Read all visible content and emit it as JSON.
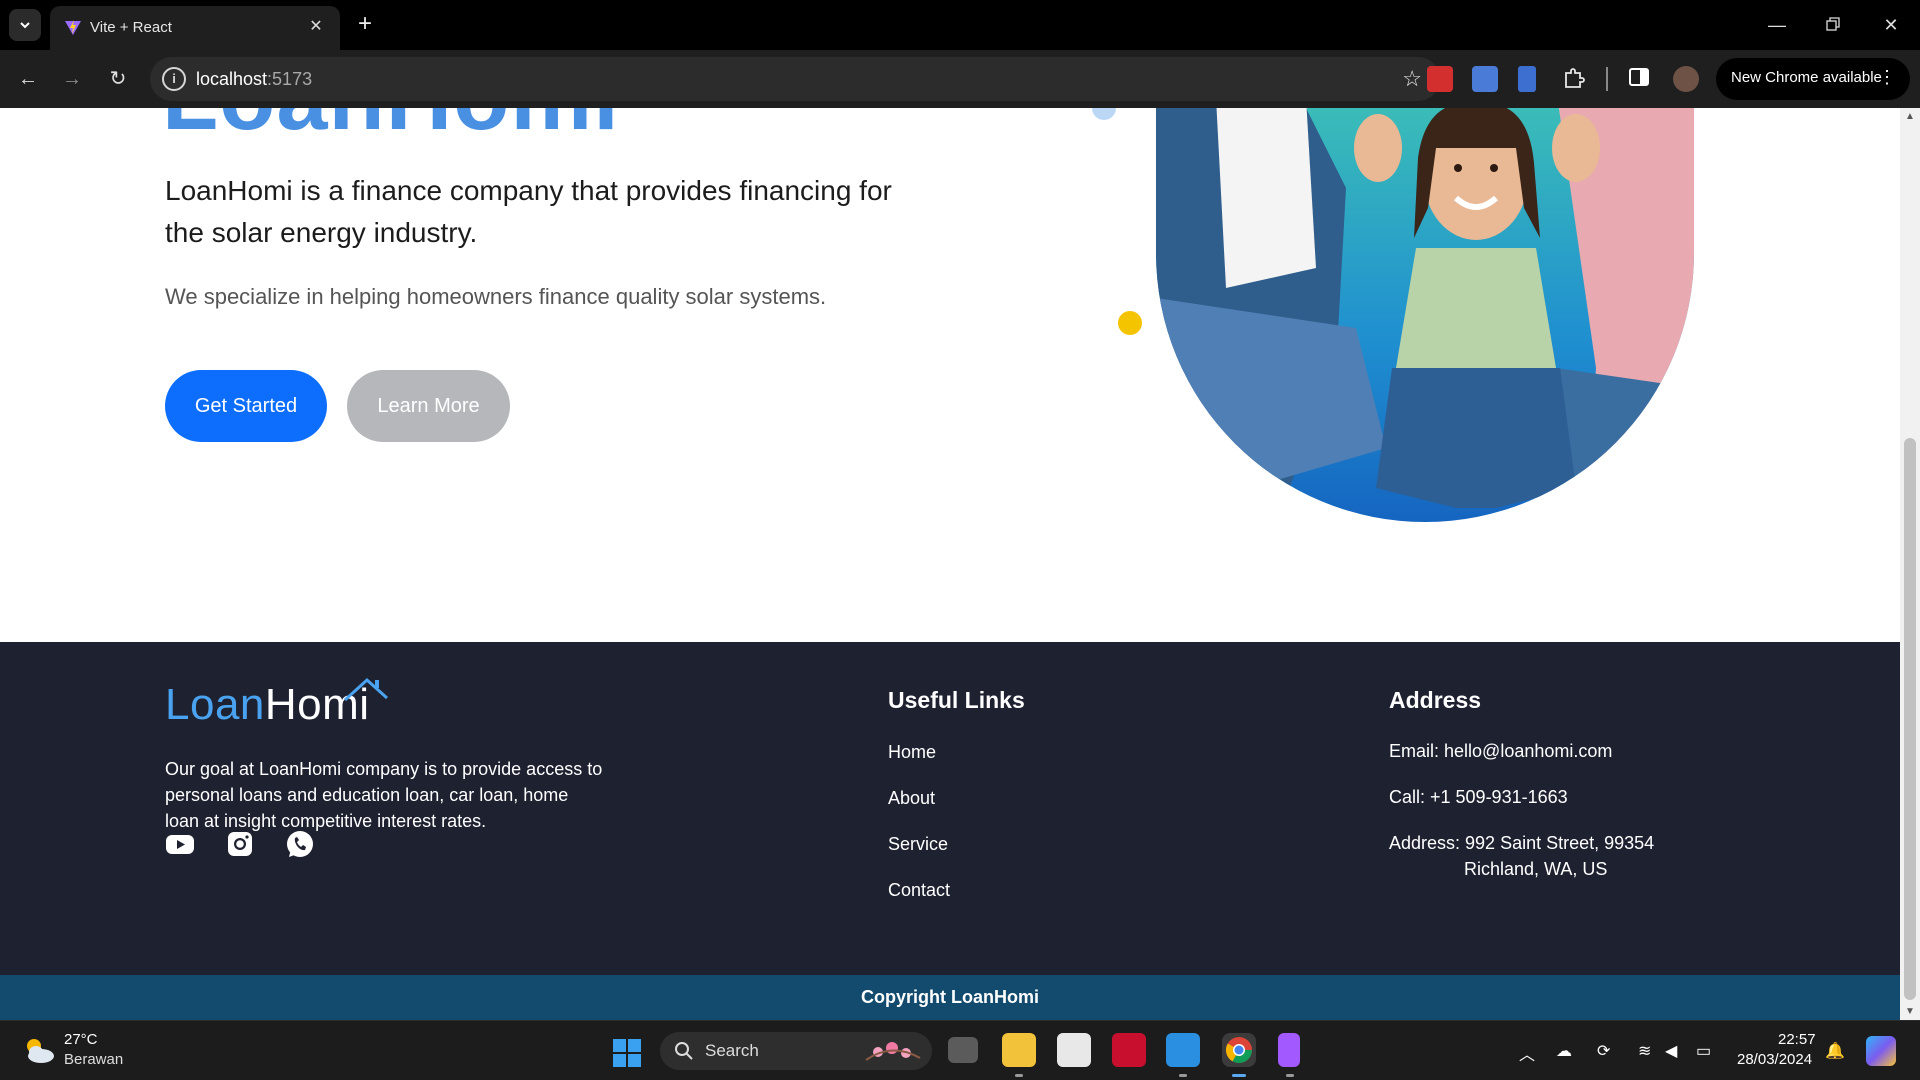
{
  "browser": {
    "tab_title": "Vite + React",
    "url_host": "localhost",
    "url_port": ":5173",
    "chrome_update": "New Chrome available"
  },
  "hero": {
    "brand": "LoanHomi",
    "lead": "LoanHomi is a finance company that provides financing for the solar energy industry.",
    "sub": "We specialize in helping homeowners finance quality solar systems.",
    "primary_button": "Get Started",
    "secondary_button": "Learn More"
  },
  "footer": {
    "logo_part1": "Loan",
    "logo_part2": "Homi",
    "about": "Our goal at LoanHomi company is to provide access to personal loans and education loan, car loan, home loan at insight competitive interest rates.",
    "useful_links_title": "Useful Links",
    "links": [
      "Home",
      "About",
      "Service",
      "Contact"
    ],
    "address_title": "Address",
    "email": "Email: hello@loanhomi.com",
    "call": "Call: +1 509-931-1663",
    "address_line1": "Address: 992 Saint Street, 99354",
    "address_line2": "Richland, WA, US",
    "copyright": "Copyright LoanHomi"
  },
  "taskbar": {
    "temperature": "27°C",
    "weather": "Berawan",
    "search": "Search",
    "time": "22:57",
    "date": "28/03/2024"
  },
  "colors": {
    "primary_button": "#0d6efd",
    "secondary_button": "#b5b7ba",
    "footer_bg": "#1e2130",
    "copyright_bg": "#134b6e",
    "brand_blue": "#4a90e2"
  }
}
